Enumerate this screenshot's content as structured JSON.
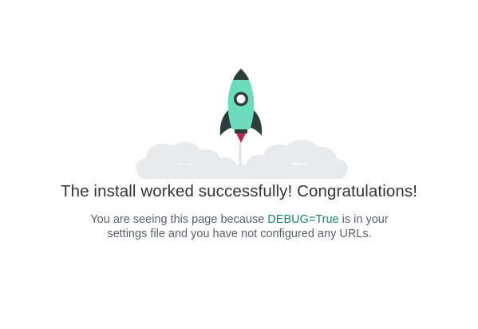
{
  "main": {
    "headline": "The install worked successfully! Congratulations!",
    "explanation_before": "You are seeing this page because ",
    "debug_setting": "DEBUG=True",
    "explanation_after": " is in your settings file and you have not configured any URLs."
  },
  "illustration": {
    "icon": "rocket-launch-icon",
    "colors": {
      "rocket_body": "#6ddcbd",
      "rocket_fins": "#2c3e3a",
      "flame": "#b62b4e",
      "clouds": "#e9eaeb",
      "debug_text": "#20826b"
    }
  }
}
